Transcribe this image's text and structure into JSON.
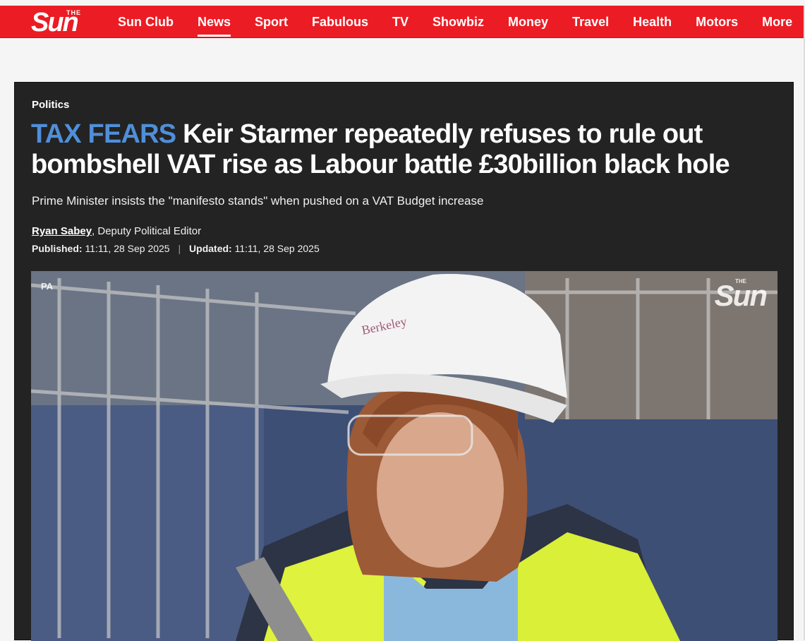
{
  "header": {
    "logo_the": "THE",
    "logo_name": "Sun",
    "nav": [
      {
        "label": "Sun Club"
      },
      {
        "label": "News",
        "active": true
      },
      {
        "label": "Sport"
      },
      {
        "label": "Fabulous"
      },
      {
        "label": "TV"
      },
      {
        "label": "Showbiz"
      },
      {
        "label": "Money"
      },
      {
        "label": "Travel"
      },
      {
        "label": "Health"
      },
      {
        "label": "Motors"
      },
      {
        "label": "More"
      }
    ],
    "brand_color": "#eb1c24"
  },
  "article": {
    "section": "Politics",
    "headline_tag": "TAX FEARS",
    "headline": "Keir Starmer repeatedly refuses to rule out bombshell VAT rise as Labour battle £30billion black hole",
    "standfirst": "Prime Minister insists the \"manifesto stands\" when pushed on a VAT Budget increase",
    "author": "Ryan Sabey",
    "author_role": ", Deputy Political Editor",
    "published_label": "Published:",
    "published": "11:11, 28 Sep 2025",
    "updated_label": "Updated:",
    "updated": "11:11, 28 Sep 2025",
    "tag_color": "#4f8fd9",
    "media": {
      "credit": "PA",
      "watermark_the": "THE",
      "watermark": "Sun"
    }
  }
}
